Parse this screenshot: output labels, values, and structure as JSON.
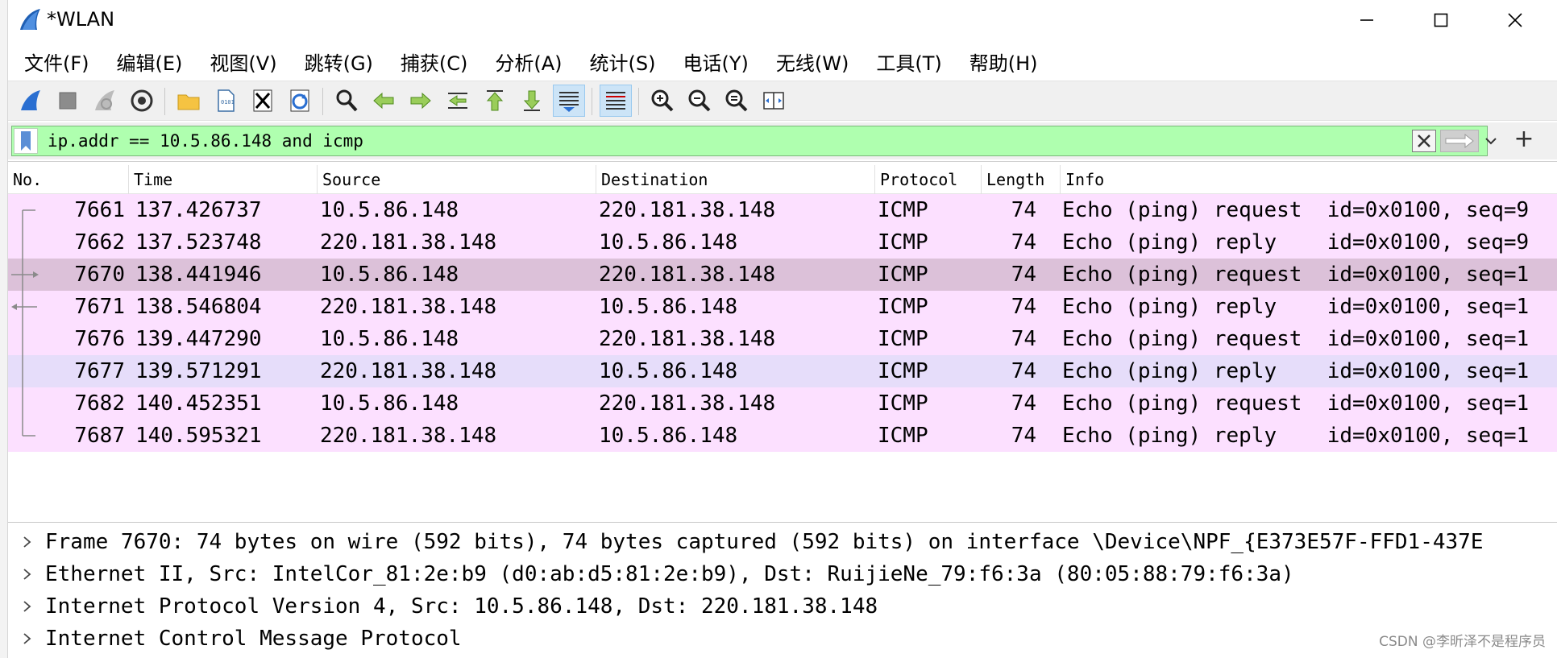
{
  "window": {
    "title": "*WLAN"
  },
  "menu": [
    {
      "label": "文件(F)"
    },
    {
      "label": "编辑(E)"
    },
    {
      "label": "视图(V)"
    },
    {
      "label": "跳转(G)"
    },
    {
      "label": "捕获(C)"
    },
    {
      "label": "分析(A)"
    },
    {
      "label": "统计(S)"
    },
    {
      "label": "电话(Y)"
    },
    {
      "label": "无线(W)"
    },
    {
      "label": "工具(T)"
    },
    {
      "label": "帮助(H)"
    }
  ],
  "toolbar": {
    "icons": [
      "shark-fin-icon",
      "stop-icon",
      "restart-icon",
      "options-gear-icon",
      "open-folder-icon",
      "save-file-icon",
      "close-file-icon",
      "reload-icon",
      "find-icon",
      "back-arrow-icon",
      "forward-arrow-icon",
      "goto-packet-icon",
      "first-packet-icon",
      "last-packet-icon",
      "autoscroll-icon",
      "colorize-icon",
      "zoom-in-icon",
      "zoom-out-icon",
      "zoom-normal-icon",
      "resize-columns-icon"
    ]
  },
  "filter": {
    "value": "ip.addr == 10.5.86.148 and icmp"
  },
  "columns": [
    "No.",
    "Time",
    "Source",
    "Destination",
    "Protocol",
    "Length",
    "Info"
  ],
  "packets": [
    {
      "no": "7661",
      "time": "137.426737",
      "source": "10.5.86.148",
      "destination": "220.181.38.148",
      "protocol": "ICMP",
      "length": "74",
      "info": "Echo (ping) request  id=0x0100, seq=9",
      "color": "#fce0ff"
    },
    {
      "no": "7662",
      "time": "137.523748",
      "source": "220.181.38.148",
      "destination": "10.5.86.148",
      "protocol": "ICMP",
      "length": "74",
      "info": "Echo (ping) reply    id=0x0100, seq=9",
      "color": "#fce0ff"
    },
    {
      "no": "7670",
      "time": "138.441946",
      "source": "10.5.86.148",
      "destination": "220.181.38.148",
      "protocol": "ICMP",
      "length": "74",
      "info": "Echo (ping) request  id=0x0100, seq=1",
      "color": "#dcc1d9"
    },
    {
      "no": "7671",
      "time": "138.546804",
      "source": "220.181.38.148",
      "destination": "10.5.86.148",
      "protocol": "ICMP",
      "length": "74",
      "info": "Echo (ping) reply    id=0x0100, seq=1",
      "color": "#fce0ff"
    },
    {
      "no": "7676",
      "time": "139.447290",
      "source": "10.5.86.148",
      "destination": "220.181.38.148",
      "protocol": "ICMP",
      "length": "74",
      "info": "Echo (ping) request  id=0x0100, seq=1",
      "color": "#fce0ff"
    },
    {
      "no": "7677",
      "time": "139.571291",
      "source": "220.181.38.148",
      "destination": "10.5.86.148",
      "protocol": "ICMP",
      "length": "74",
      "info": "Echo (ping) reply    id=0x0100, seq=1",
      "color": "#e6ddfa"
    },
    {
      "no": "7682",
      "time": "140.452351",
      "source": "10.5.86.148",
      "destination": "220.181.38.148",
      "protocol": "ICMP",
      "length": "74",
      "info": "Echo (ping) request  id=0x0100, seq=1",
      "color": "#fce0ff"
    },
    {
      "no": "7687",
      "time": "140.595321",
      "source": "220.181.38.148",
      "destination": "10.5.86.148",
      "protocol": "ICMP",
      "length": "74",
      "info": "Echo (ping) reply    id=0x0100, seq=1",
      "color": "#fce0ff"
    }
  ],
  "details": [
    {
      "text": "Frame 7670: 74 bytes on wire (592 bits), 74 bytes captured (592 bits) on interface \\Device\\NPF_{E373E57F-FFD1-437E"
    },
    {
      "text": "Ethernet II, Src: IntelCor_81:2e:b9 (d0:ab:d5:81:2e:b9), Dst: RuijieNe_79:f6:3a (80:05:88:79:f6:3a)"
    },
    {
      "text": "Internet Protocol Version 4, Src: 10.5.86.148, Dst: 220.181.38.148"
    },
    {
      "text": "Internet Control Message Protocol"
    }
  ],
  "watermark": "CSDN @李昕泽不是程序员"
}
